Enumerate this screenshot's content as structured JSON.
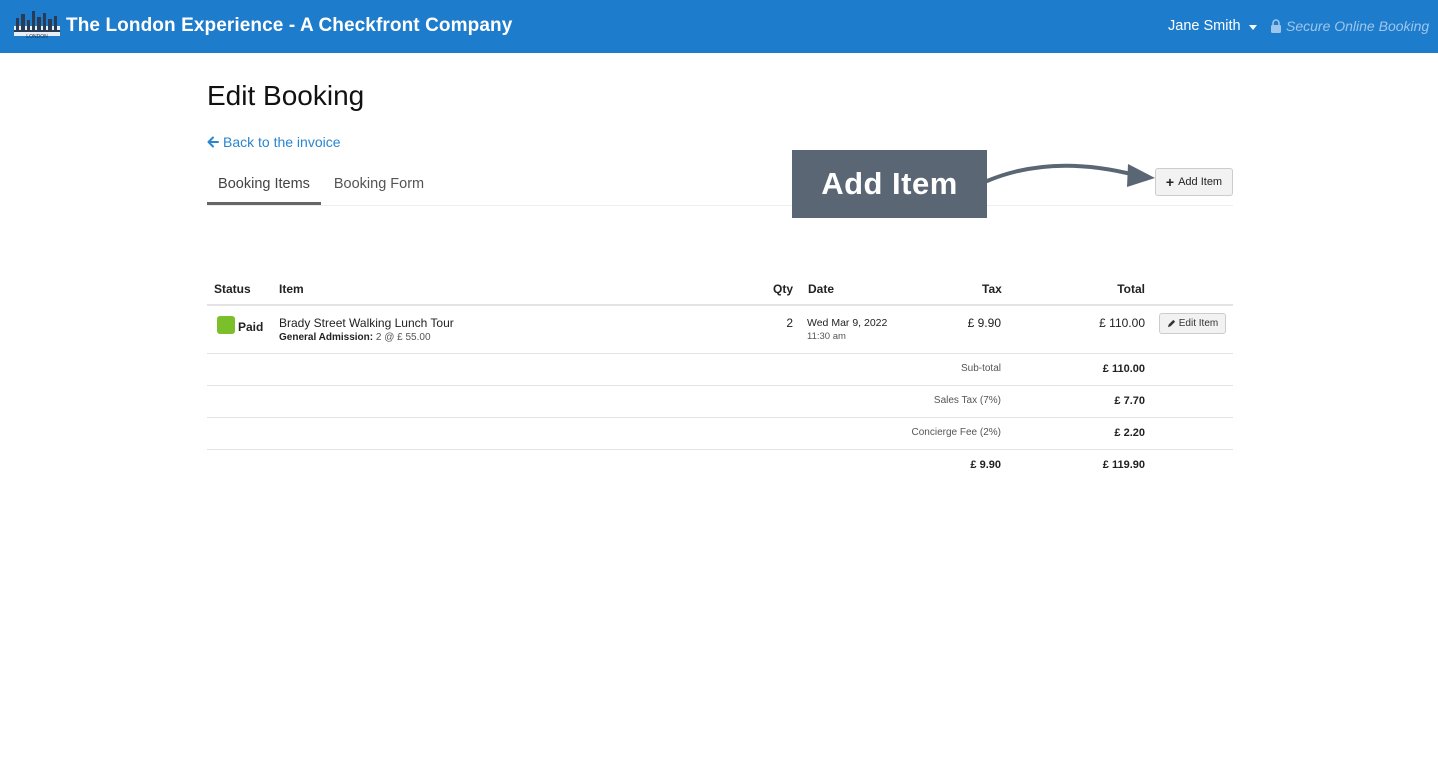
{
  "header": {
    "brand": "The London Experience - A Checkfront Company",
    "logo_text": "LONDON",
    "user_name": "Jane Smith",
    "secure_label": "Secure Online Booking"
  },
  "page": {
    "title": "Edit Booking",
    "back_link": "Back to the invoice",
    "tabs": [
      {
        "label": "Booking Items",
        "active": true
      },
      {
        "label": "Booking Form",
        "active": false
      }
    ],
    "callout": "Add Item",
    "add_item_button": "Add Item"
  },
  "table": {
    "columns": [
      "Status",
      "Item",
      "Qty",
      "Date",
      "Tax",
      "Total"
    ],
    "rows": [
      {
        "status": "Paid",
        "status_color": "#7bbf2a",
        "item_name": "Brady Street Walking Lunch Tour",
        "item_detail_label": "General Admission:",
        "item_detail_value": "2 @ £ 55.00",
        "qty": "2",
        "date": "Wed Mar 9, 2022",
        "time": "11:30 am",
        "tax": "£ 9.90",
        "total": "£ 110.00",
        "edit_label": "Edit Item"
      }
    ],
    "summary": [
      {
        "label": "Sub-total",
        "value": "£ 110.00"
      },
      {
        "label": "Sales Tax (7%)",
        "value": "£ 7.70"
      },
      {
        "label": "Concierge Fee (2%)",
        "value": "£ 2.20"
      }
    ],
    "totals": {
      "tax": "£ 9.90",
      "total": "£ 119.90"
    }
  },
  "colors": {
    "header_bg": "#1e7ccd",
    "link": "#2a85cf",
    "callout_bg": "#5b6675",
    "paid": "#7bbf2a"
  }
}
